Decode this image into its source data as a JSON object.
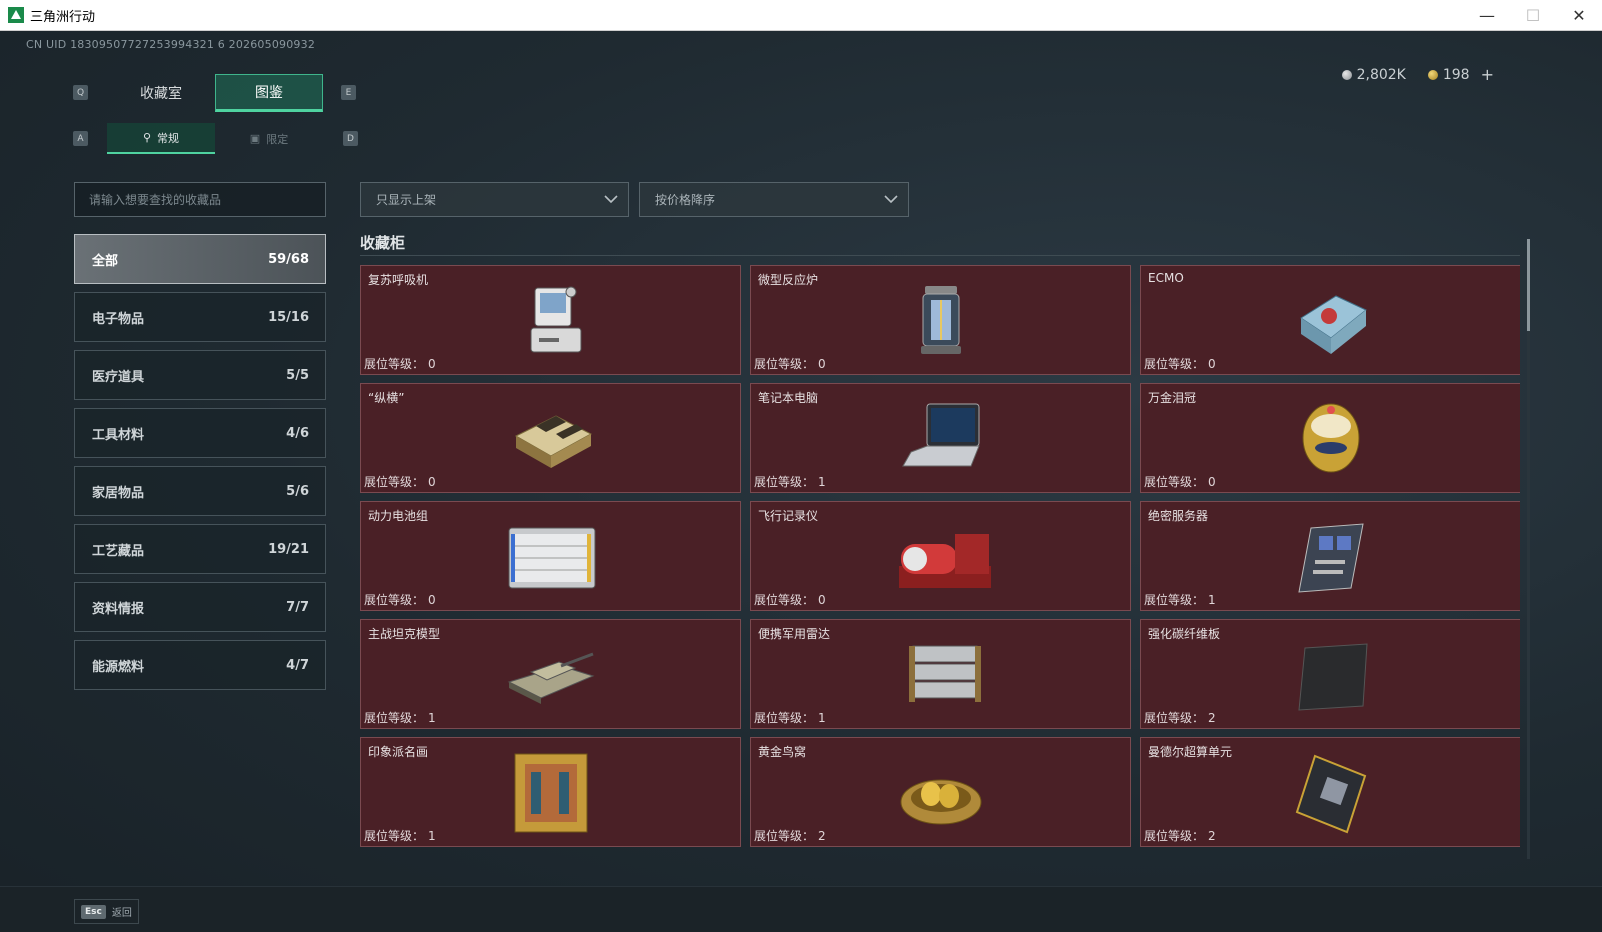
{
  "window": {
    "title": "三角洲行动"
  },
  "uid": "CN UID 18309507727253994321 6 202605090932",
  "currency": {
    "silver": "2,802K",
    "gold": "198",
    "add_label": "+"
  },
  "key_hints": {
    "prev_tab": "Q",
    "next_tab": "E",
    "prev_sub": "A",
    "next_sub": "D"
  },
  "top_tabs": [
    {
      "label": "收藏室",
      "active": false
    },
    {
      "label": "图鉴",
      "active": true
    }
  ],
  "sub_tabs": [
    {
      "label": "常规",
      "icon": "key-icon",
      "active": true
    },
    {
      "label": "限定",
      "icon": "image-icon",
      "active": false
    }
  ],
  "search": {
    "placeholder": "请输入想要查找的收藏品"
  },
  "filters": {
    "display": "只显示上架",
    "sort": "按价格降序"
  },
  "categories": [
    {
      "label": "全部",
      "count": "59/68",
      "active": true
    },
    {
      "label": "电子物品",
      "count": "15/16"
    },
    {
      "label": "医疗道具",
      "count": "5/5"
    },
    {
      "label": "工具材料",
      "count": "4/6"
    },
    {
      "label": "家居物品",
      "count": "5/6"
    },
    {
      "label": "工艺藏品",
      "count": "19/21"
    },
    {
      "label": "资料情报",
      "count": "7/7"
    },
    {
      "label": "能源燃料",
      "count": "4/7"
    }
  ],
  "section": {
    "title": "收藏柜"
  },
  "level_label": "展位等级：",
  "items": [
    {
      "name": "复苏呼吸机",
      "level": "0",
      "icon": "ventilator-icon"
    },
    {
      "name": "微型反应炉",
      "level": "0",
      "icon": "reactor-icon"
    },
    {
      "name": "ECMO",
      "level": "0",
      "icon": "ecmo-icon"
    },
    {
      "name": "“纵横”",
      "level": "0",
      "icon": "chess-board-icon"
    },
    {
      "name": "笔记本电脑",
      "level": "1",
      "icon": "laptop-icon"
    },
    {
      "name": "万金泪冠",
      "level": "0",
      "icon": "jewel-egg-icon"
    },
    {
      "name": "动力电池组",
      "level": "0",
      "icon": "battery-pack-icon"
    },
    {
      "name": "飞行记录仪",
      "level": "0",
      "icon": "flight-recorder-icon"
    },
    {
      "name": "绝密服务器",
      "level": "1",
      "icon": "server-icon"
    },
    {
      "name": "主战坦克模型",
      "level": "1",
      "icon": "tank-model-icon"
    },
    {
      "name": "便携军用雷达",
      "level": "1",
      "icon": "radar-icon"
    },
    {
      "name": "强化碳纤维板",
      "level": "2",
      "icon": "carbon-plate-icon"
    },
    {
      "name": "印象派名画",
      "level": "1",
      "icon": "painting-icon"
    },
    {
      "name": "黄金鸟窝",
      "level": "2",
      "icon": "golden-nest-icon"
    },
    {
      "name": "曼德尔超算单元",
      "level": "2",
      "icon": "compute-unit-icon"
    }
  ],
  "footer": {
    "esc_key": "Esc",
    "esc_label": "返回"
  }
}
